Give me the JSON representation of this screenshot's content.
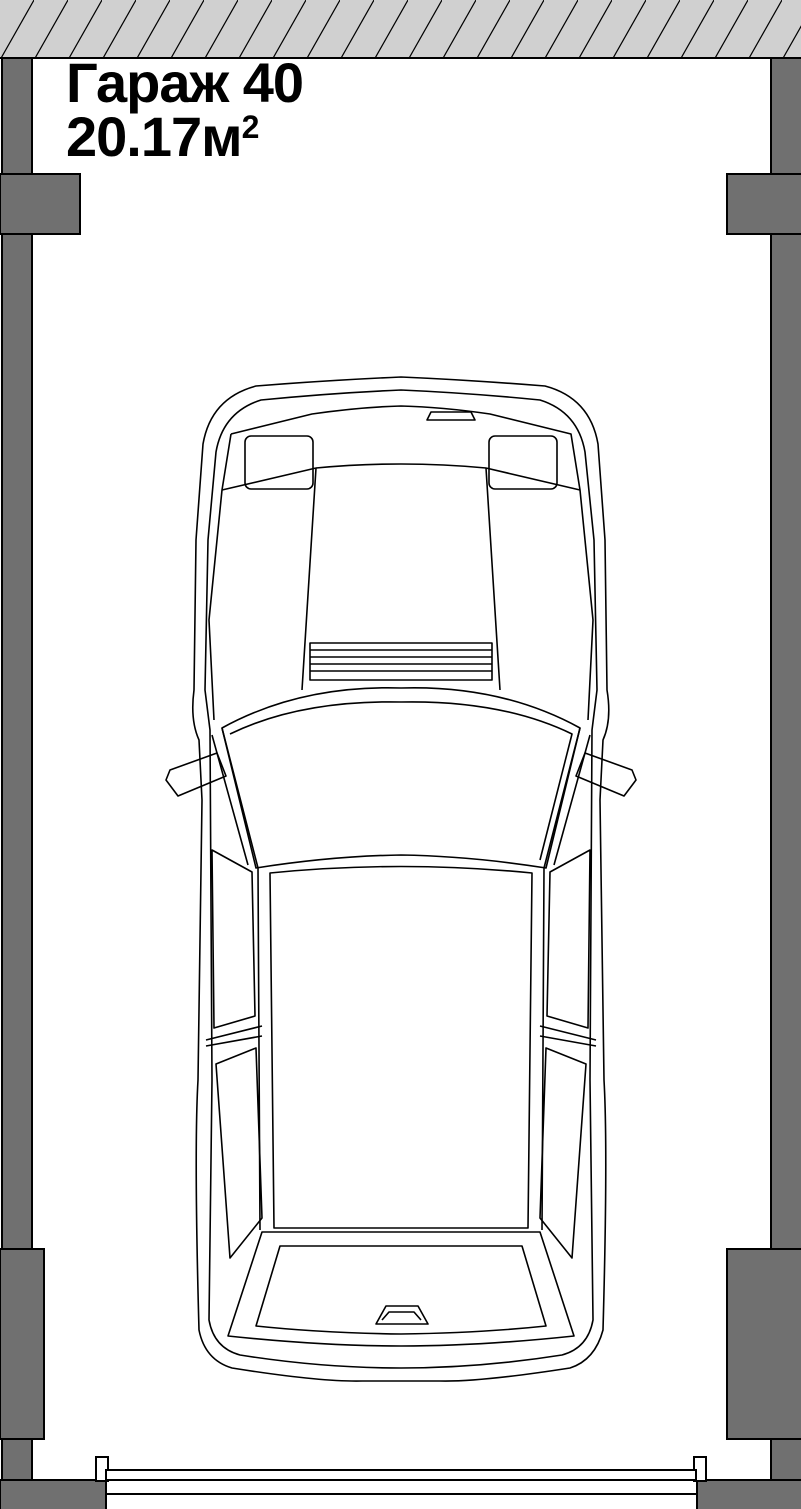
{
  "room": {
    "name": "Гараж 40",
    "area_value": "20.17м",
    "area_exponent": "2"
  },
  "colors": {
    "wall": "#707070",
    "wall_stroke": "#000000",
    "hatch_fill": "#d0d0d0",
    "floor": "#ffffff",
    "car_line": "#000000"
  },
  "icons": {
    "car": "car-top-view-icon",
    "gate": "garage-gate-icon"
  }
}
